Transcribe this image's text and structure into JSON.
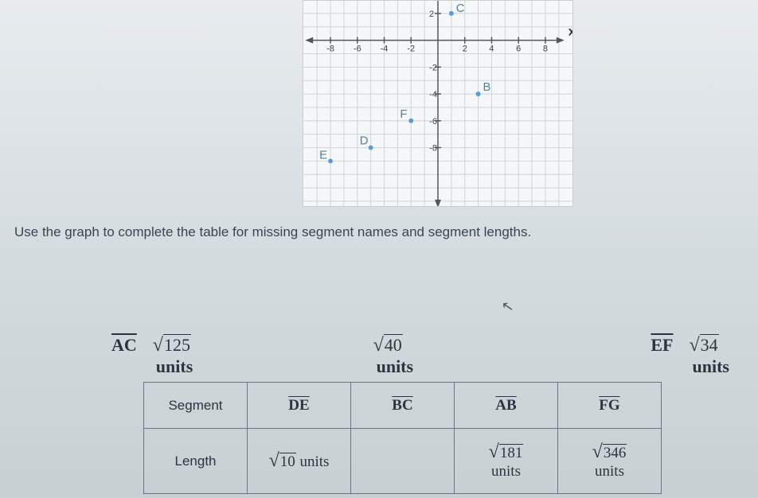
{
  "chart_data": {
    "type": "scatter",
    "xlabel": "x",
    "ylabel": "",
    "xlim": [
      -9,
      9
    ],
    "ylim": [
      -10,
      3
    ],
    "xticks": [
      -8,
      -6,
      -4,
      -2,
      2,
      4,
      6,
      8
    ],
    "yticks": [
      2,
      -2,
      -4,
      -6,
      -8
    ],
    "points": [
      {
        "name": "C",
        "x": 1,
        "y": 2
      },
      {
        "name": "B",
        "x": 3,
        "y": -4
      },
      {
        "name": "F",
        "x": -2,
        "y": -6
      },
      {
        "name": "D",
        "x": -5,
        "y": -8
      },
      {
        "name": "E",
        "x": -8,
        "y": -9
      }
    ]
  },
  "instruction": "Use the graph to complete the table for missing segment names and segment lengths.",
  "choices": {
    "c1": {
      "seg": "AC",
      "val": "125",
      "units": "units"
    },
    "c2": {
      "seg": "",
      "val": "40",
      "units": "units"
    },
    "c3": {
      "seg": "EF",
      "val": "34",
      "units": "units"
    }
  },
  "table": {
    "r1label": "Segment",
    "r2label": "Length",
    "cols": [
      {
        "seg": "DE",
        "len": "10",
        "units": "units"
      },
      {
        "seg": "BC",
        "len": "",
        "units": ""
      },
      {
        "seg": "AB",
        "len": "181",
        "units": "units"
      },
      {
        "seg": "FG",
        "len": "346",
        "units": "units"
      }
    ]
  }
}
